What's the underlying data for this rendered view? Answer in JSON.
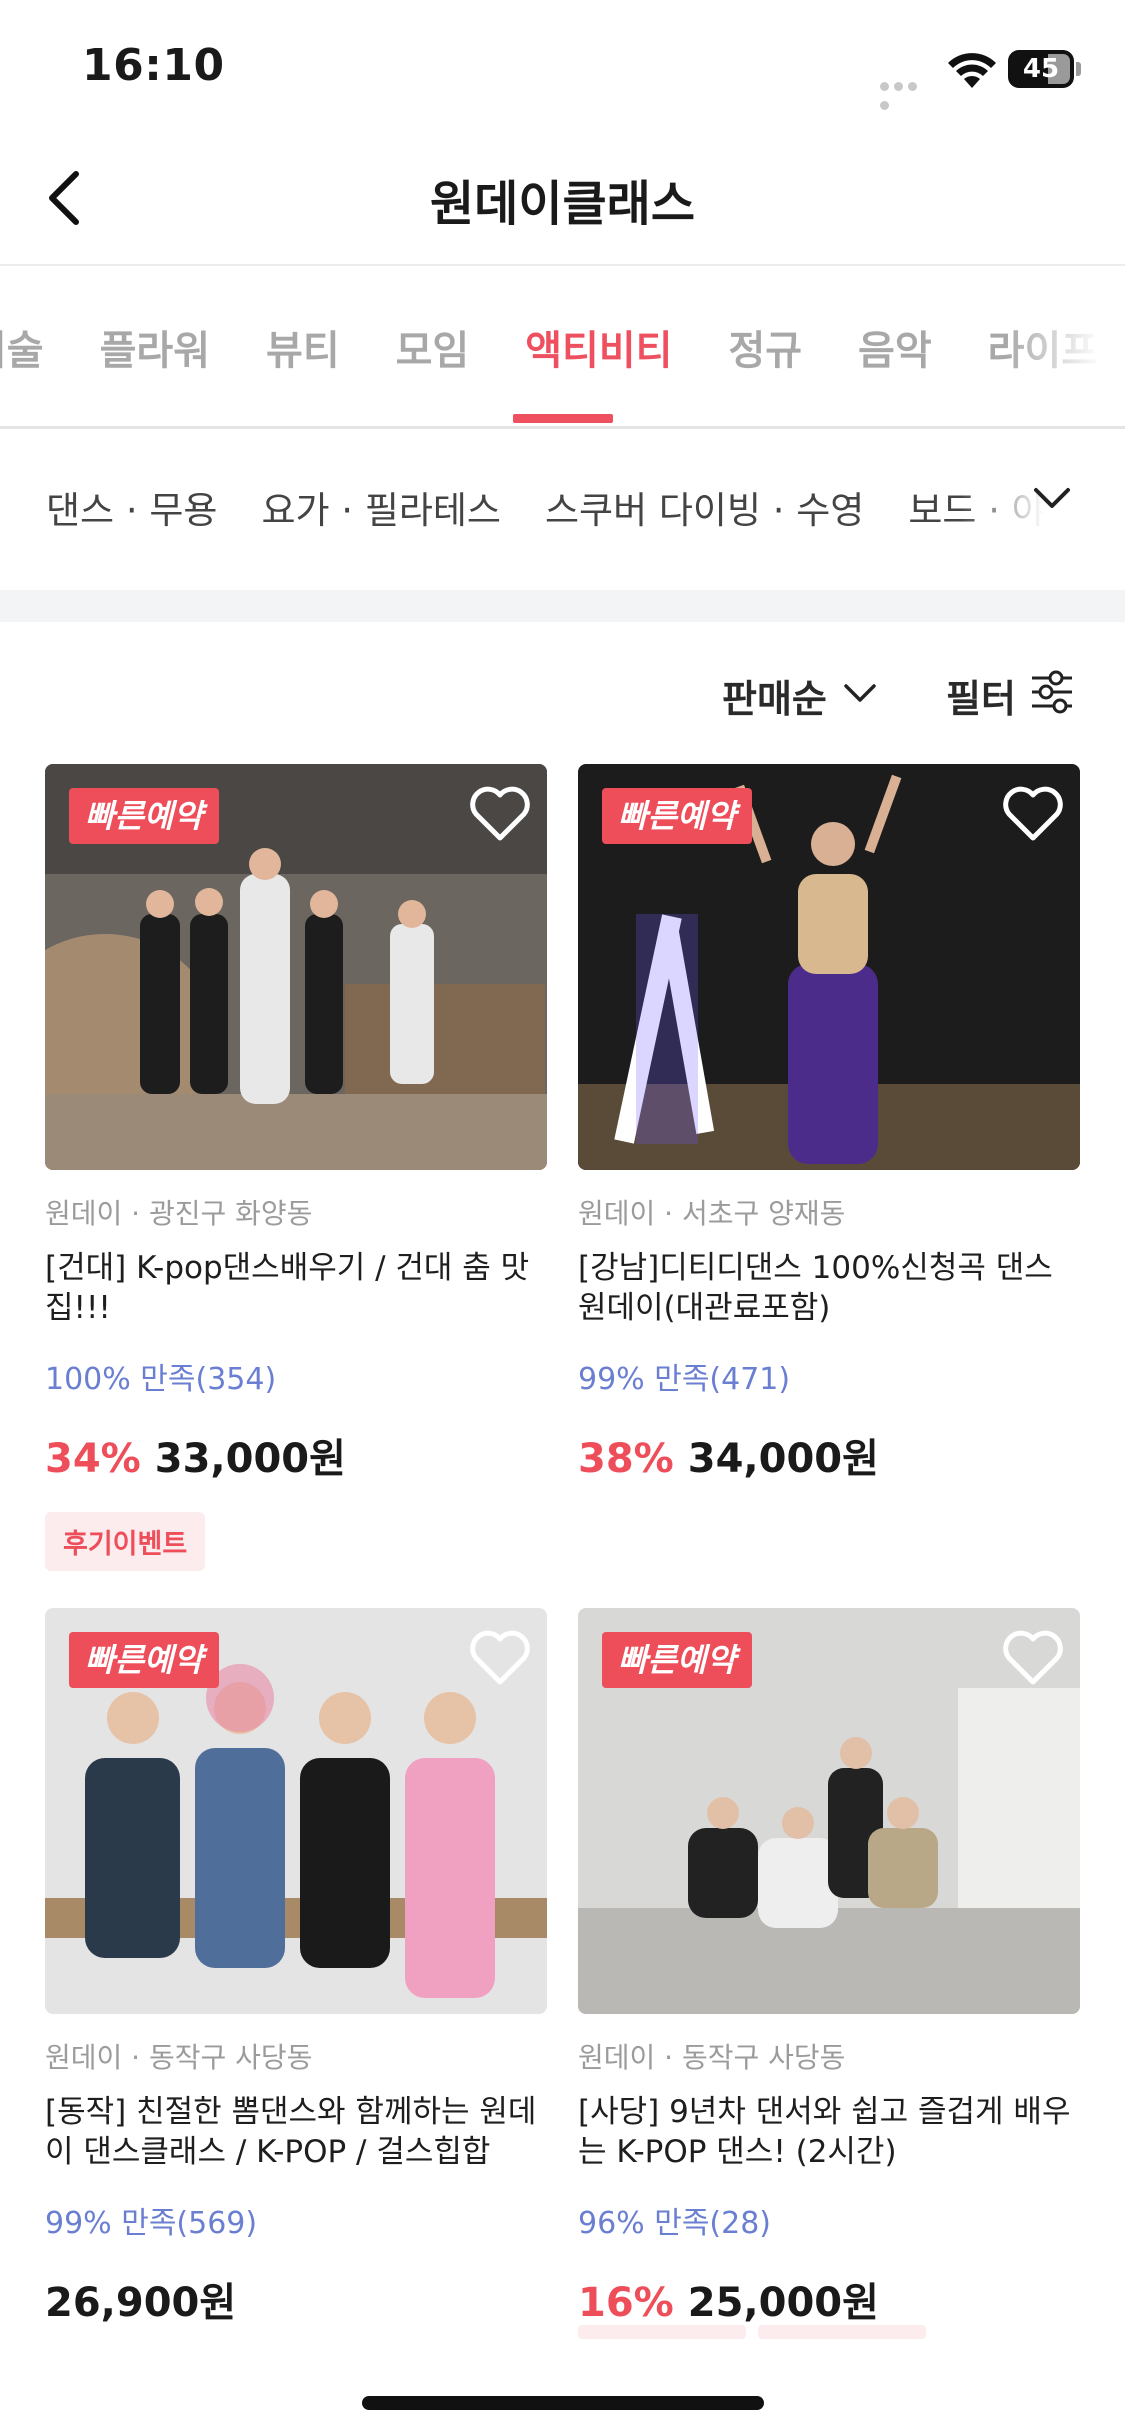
{
  "status_bar": {
    "time": "16:10",
    "battery": "45"
  },
  "nav": {
    "title": "원데이클래스"
  },
  "category_tabs": [
    {
      "label": "미술",
      "active": false
    },
    {
      "label": "플라워",
      "active": false
    },
    {
      "label": "뷰티",
      "active": false
    },
    {
      "label": "모임",
      "active": false
    },
    {
      "label": "액티비티",
      "active": true
    },
    {
      "label": "정규",
      "active": false
    },
    {
      "label": "음악",
      "active": false
    },
    {
      "label": "라이프스타일",
      "active": false
    }
  ],
  "sub_categories": [
    "댄스 · 무용",
    "요가 · 필라테스",
    "스쿠버 다이빙 · 수영",
    "보드 · 야외"
  ],
  "sort": {
    "label": "판매순"
  },
  "filter": {
    "label": "필터"
  },
  "colors": {
    "accent": "#ee4e5a",
    "rating": "#6a7fd2"
  },
  "products": [
    {
      "badge": "빠른예약",
      "location": "원데이 · 광진구 화양동",
      "title": "[건대] K-pop댄스배우기 / 건대 춤 맛집!!!",
      "rating": "100% 만족(354)",
      "discount": "34%",
      "price": "33,000원",
      "tag": "후기이벤트",
      "liked": false
    },
    {
      "badge": "빠른예약",
      "location": "원데이 · 서초구 양재동",
      "title": "[강남]디티디댄스 100%신청곡 댄스원데이(대관료포함)",
      "rating": "99% 만족(471)",
      "discount": "38%",
      "price": "34,000원",
      "tag": "",
      "liked": false
    },
    {
      "badge": "빠른예약",
      "location": "원데이 · 동작구 사당동",
      "title": "[동작] 친절한 뽐댄스와 함께하는 원데이 댄스클래스 / K-POP / 걸스힙합",
      "rating": "99% 만족(569)",
      "discount": "",
      "price": "26,900원",
      "tag": "",
      "liked": false
    },
    {
      "badge": "빠른예약",
      "location": "원데이 · 동작구 사당동",
      "title": "[사당] 9년차 댄서와 쉽고 즐겁게 배우는 K-POP 댄스! (2시간)",
      "rating": "96% 만족(28)",
      "discount": "16%",
      "price": "25,000원",
      "tag": "",
      "liked": false
    }
  ]
}
